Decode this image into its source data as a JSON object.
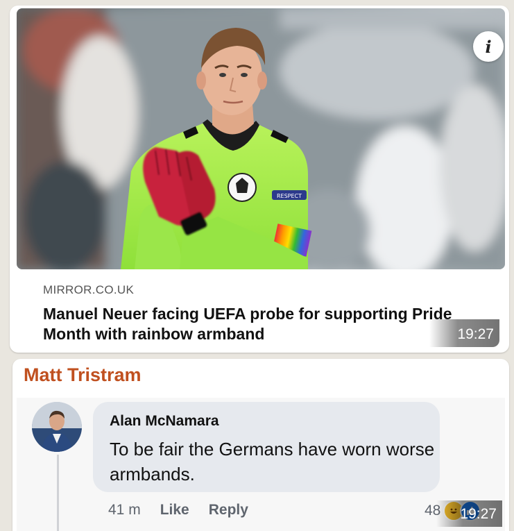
{
  "link_preview": {
    "domain": "MIRROR.CO.UK",
    "title": "Manuel Neuer facing UEFA probe for supporting Pride Month with rainbow armband",
    "timestamp": "19:27",
    "info_icon": "info-icon",
    "info_glyph": "i"
  },
  "message2": {
    "sender": "Matt Tristram",
    "sender_color": "#c0501f",
    "timestamp": "19:27",
    "comment": {
      "author": "Alan McNamara",
      "text": "To be fair the Germans have worn worse armbands.",
      "age": "41 m",
      "like_label": "Like",
      "reply_label": "Reply",
      "reaction_count": "48",
      "reaction_icons": [
        "laugh-react-icon",
        "like-react-icon"
      ]
    }
  }
}
